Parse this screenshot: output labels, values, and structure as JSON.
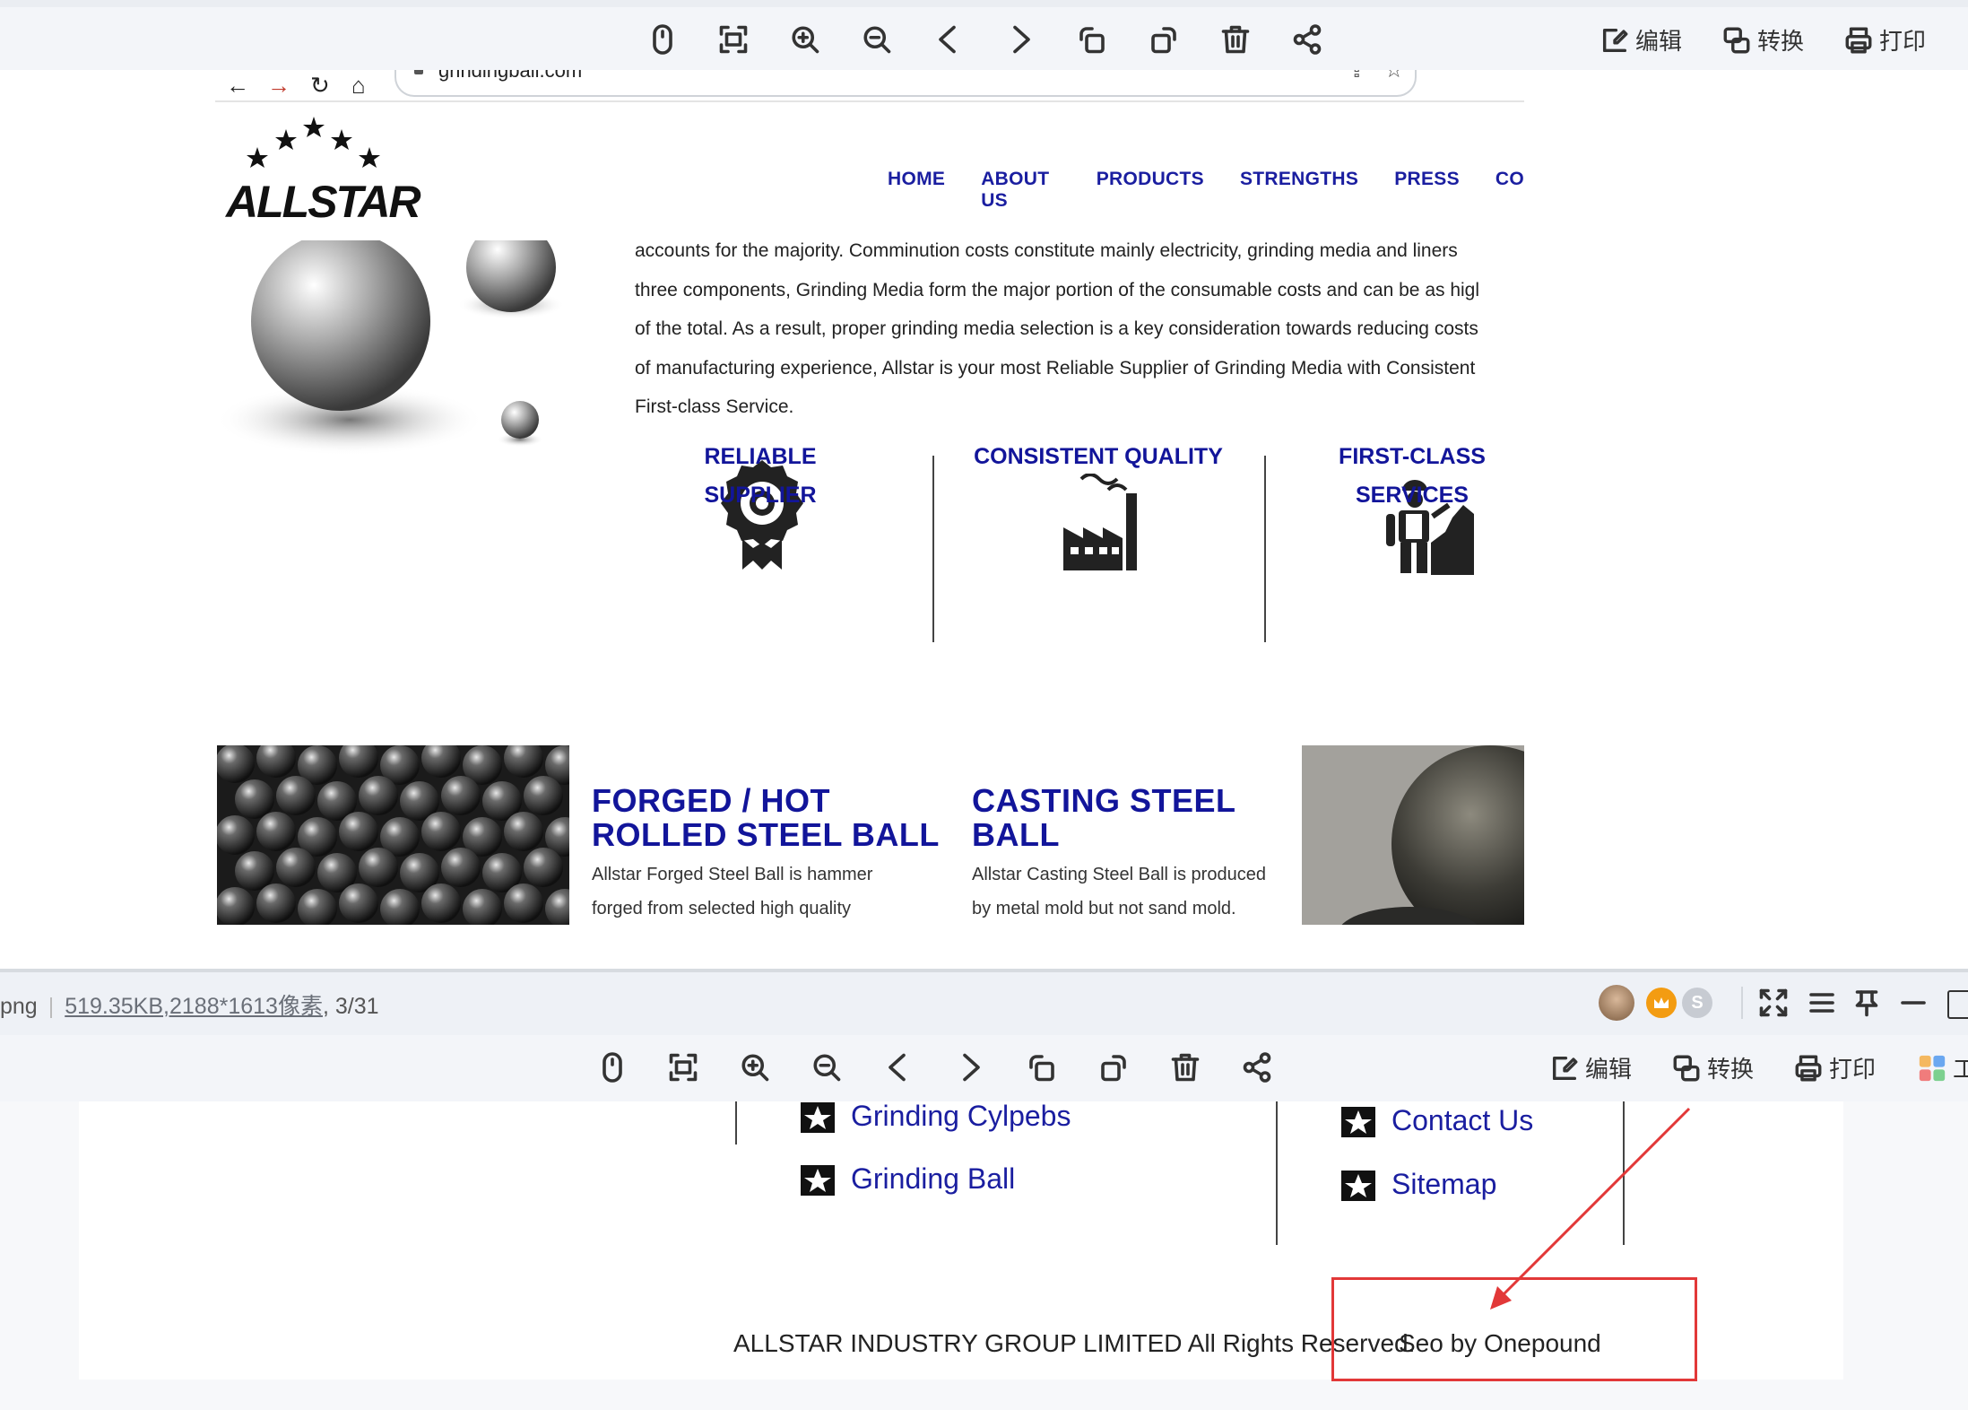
{
  "viewer": {
    "actions": {
      "edit": "编辑",
      "convert": "转换",
      "print": "打印",
      "tools_partial": "工"
    },
    "icons": [
      "mouse-icon",
      "fit-screen-icon",
      "zoom-in-icon",
      "zoom-out-icon",
      "previous-icon",
      "next-icon",
      "rotate-left-icon",
      "rotate-right-icon",
      "delete-icon",
      "share-icon"
    ],
    "status": {
      "file_ext_partial": "png",
      "file_size": "519.35KB",
      "dimensions": ",2188*1613像素",
      "page_counter": ", 3/31"
    },
    "window_controls": [
      "avatar",
      "crown-badge",
      "s-badge",
      "fullscreen-icon",
      "menu-icon",
      "pin-icon",
      "minimize-icon",
      "maximize-icon"
    ]
  },
  "browser": {
    "url": "grindingball.com"
  },
  "site": {
    "logo_text": "ALLSTAR",
    "nav": [
      "HOME",
      "ABOUT US",
      "PRODUCTS",
      "STRENGTHS",
      "PRESS",
      "CO"
    ],
    "intro_lines": [
      "accounts for the majority. Comminution costs constitute mainly electricity, grinding media and liners",
      "three components, Grinding Media form the major portion of the consumable costs and can be as higl",
      "of the total. As a result, proper grinding media selection is a key consideration towards reducing costs",
      "of manufacturing experience, Allstar is your most Reliable Supplier of Grinding Media with Consistent",
      "First-class Service."
    ],
    "features": [
      {
        "label": "RELIABLE SUPPLIER",
        "icon": "award-badge-icon"
      },
      {
        "label": "CONSISTENT QUALITY",
        "icon": "factory-icon"
      },
      {
        "label_line1": "FIRST-CLASS",
        "label_line2": "SERVICES",
        "icon": "worker-icon"
      }
    ],
    "products": [
      {
        "title_line1": "FORGED / HOT",
        "title_line2": "ROLLED STEEL BALL",
        "desc_line1": "Allstar Forged Steel Ball is hammer",
        "desc_line2": "forged from selected high quality"
      },
      {
        "title_line1": "CASTING STEEL",
        "title_line2": "BALL",
        "desc_line1": "Allstar Casting Steel Ball is produced",
        "desc_line2": "by metal mold but not sand mold."
      }
    ]
  },
  "footer": {
    "links_col1": [
      "Grinding Cylpebs",
      "Grinding Ball"
    ],
    "links_col2": [
      "Contact Us",
      "Sitemap"
    ],
    "copyright": "ALLSTAR INDUSTRY GROUP LIMITED All Rights Reserved.",
    "seo_credit": "Seo by Onepound"
  },
  "annotation": {
    "color": "#e23838"
  },
  "colors": {
    "brand_blue": "#12159a",
    "toolbar_bg": "#f3f5f9"
  }
}
